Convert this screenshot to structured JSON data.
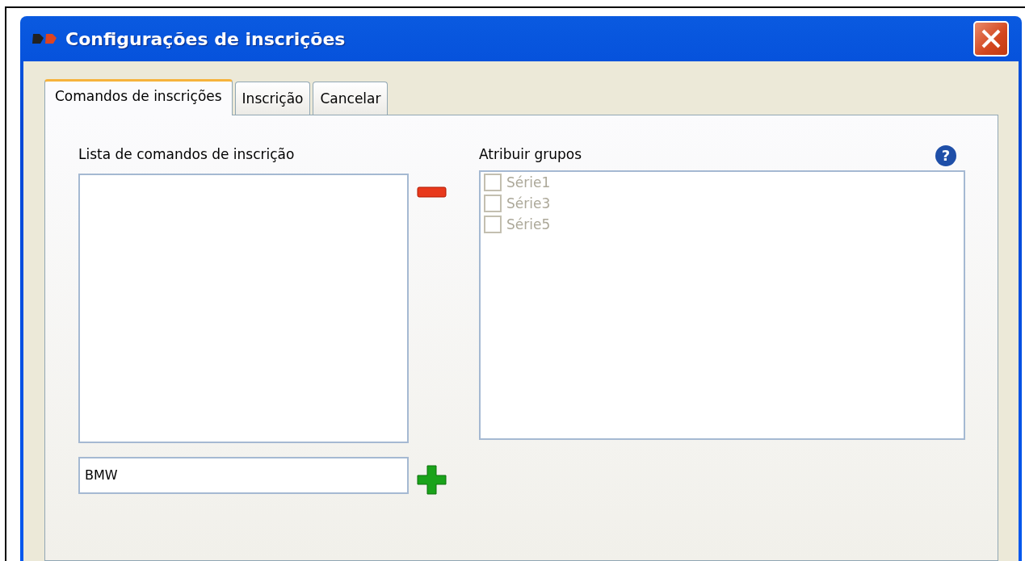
{
  "window": {
    "title": "Configurações de inscrições"
  },
  "tabs": [
    {
      "label": "Comandos de inscrições",
      "selected": true
    },
    {
      "label": "Inscrição",
      "selected": false
    },
    {
      "label": "Cancelar",
      "selected": false
    }
  ],
  "commands": {
    "label": "Lista de comandos de inscrição",
    "new_command": {
      "value": "BMW"
    }
  },
  "groups": {
    "label": "Atribuir grupos",
    "help": "?",
    "items": [
      {
        "label": "Série1",
        "checked": false,
        "disabled": true
      },
      {
        "label": "Série3",
        "checked": false,
        "disabled": true
      },
      {
        "label": "Série5",
        "checked": false,
        "disabled": true
      }
    ]
  }
}
